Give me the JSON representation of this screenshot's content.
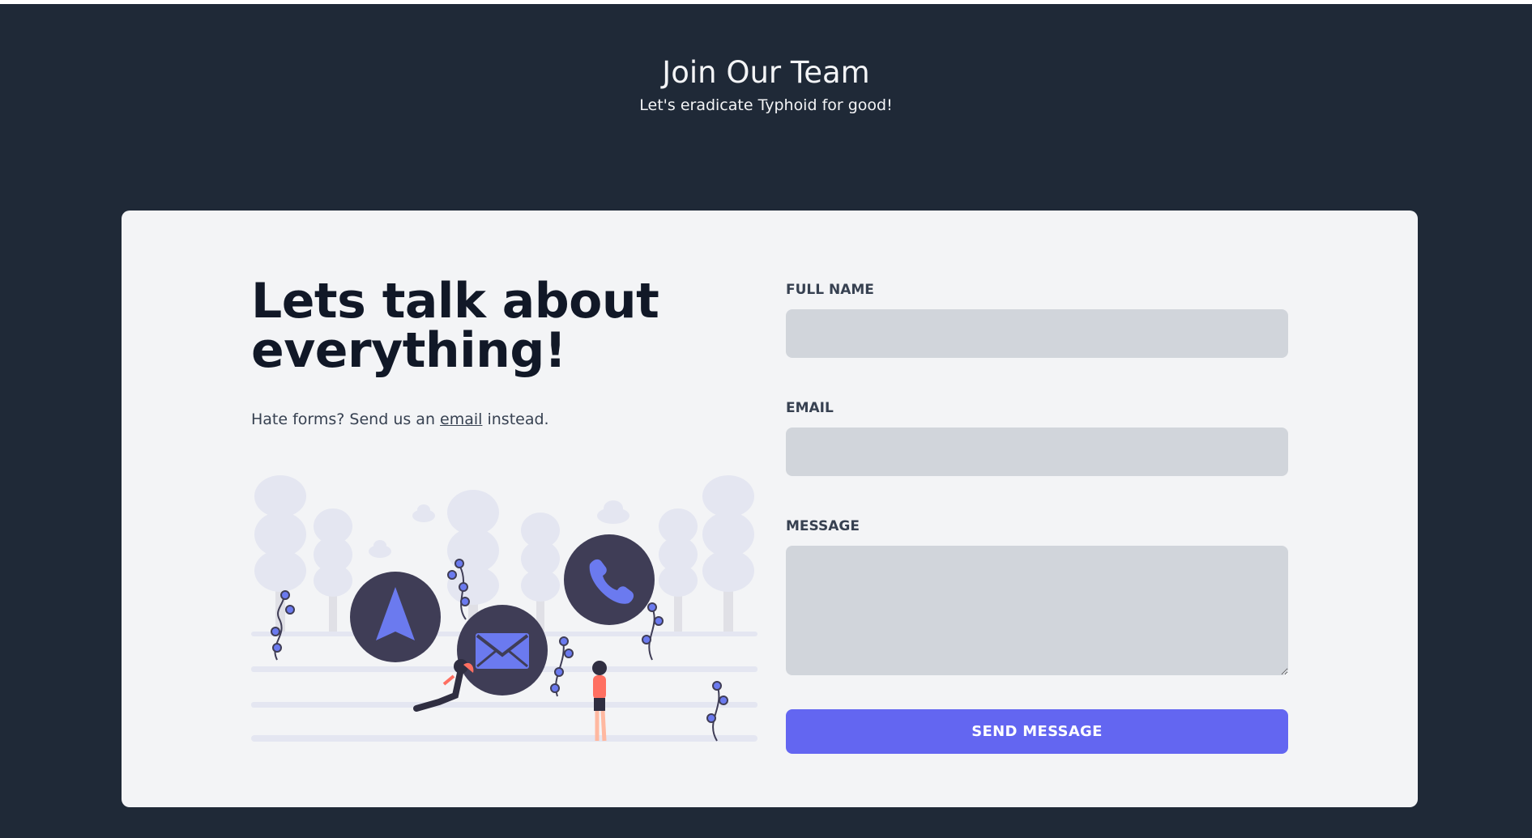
{
  "header": {
    "title": "Join Our Team",
    "subtitle": "Let's eradicate Typhoid for good!"
  },
  "contact": {
    "heading_line1": "Lets talk about",
    "heading_line2": "everything!",
    "sub_before": "Hate forms? Send us an ",
    "email_link": "email",
    "sub_after": " instead."
  },
  "form": {
    "full_name_label": "Full Name",
    "full_name_value": "",
    "email_label": "Email",
    "email_value": "",
    "message_label": "Message",
    "message_value": "",
    "submit_label": "Send Message"
  },
  "colors": {
    "background": "#1f2937",
    "card": "#f3f4f6",
    "input": "#d1d5db",
    "accent": "#6366f1",
    "illustration_dark": "#3f3d56"
  },
  "illustration": {
    "icons": [
      "navigation-arrow-icon",
      "envelope-icon",
      "phone-icon"
    ]
  }
}
